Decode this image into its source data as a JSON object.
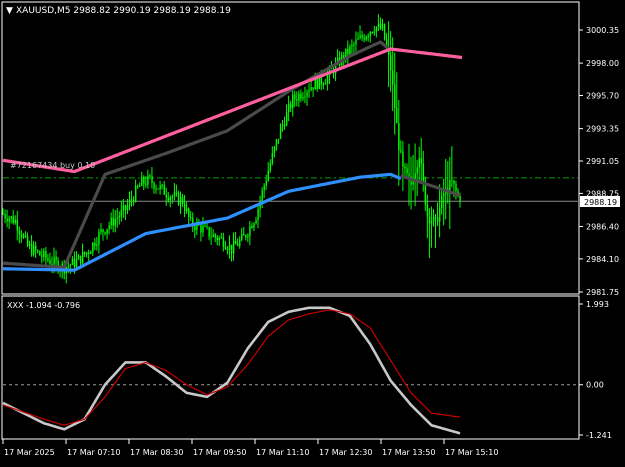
{
  "symbol_header": {
    "arrow": "▼",
    "text": "XAUUSD,M5  2988.82 2990.19 2988.19 2988.19"
  },
  "order_line_label": "#72167434 buy 0.10",
  "current_price_label": "2988.19",
  "price_axis": {
    "ticks": [
      "3000.35",
      "2998.00",
      "2995.70",
      "2993.35",
      "2991.05",
      "2988.75",
      "2986.40",
      "2984.10",
      "2981.75"
    ]
  },
  "indicator_header": "XXX -1.094 -0.796",
  "indicator_axis": {
    "ticks": [
      "1.993",
      "0.00",
      "-1.241"
    ]
  },
  "time_axis": {
    "labels": [
      "17 Mar 2025",
      "17 Mar 07:10",
      "17 Mar 08:30",
      "17 Mar 09:50",
      "17 Mar 11:10",
      "17 Mar 12:30",
      "17 Mar 13:50",
      "17 Mar 15:10"
    ]
  },
  "colors": {
    "background": "#000000",
    "candles": "#00ff00",
    "ma_dark": "#4a4a4a",
    "ma_blue": "#2f8fff",
    "ma_pink": "#ff5fa0",
    "order_line": "#00a000",
    "price_line": "#8c8c8c",
    "indicator_fast": "#c8c8c8",
    "indicator_slow": "#c80000",
    "axis": "#ffffff"
  },
  "chart_data": [
    {
      "type": "candlestick",
      "title": "XAUUSD,M5",
      "ohlc_last": {
        "open": 2988.82,
        "high": 2990.19,
        "low": 2988.19,
        "close": 2988.19
      },
      "approx_close_path": [
        [
          0,
          2987.3
        ],
        [
          6,
          2986.8
        ],
        [
          12,
          2985.0
        ],
        [
          18,
          2984.4
        ],
        [
          24,
          2983.9
        ],
        [
          30,
          2983.5
        ],
        [
          36,
          2983.9
        ],
        [
          42,
          2984.7
        ],
        [
          48,
          2986.0
        ],
        [
          54,
          2986.8
        ],
        [
          60,
          2987.6
        ],
        [
          64,
          2988.6
        ],
        [
          68,
          2989.5
        ],
        [
          72,
          2989.7
        ],
        [
          76,
          2989.2
        ],
        [
          82,
          2988.6
        ],
        [
          88,
          2988.2
        ],
        [
          92,
          2986.6
        ],
        [
          96,
          2986.4
        ],
        [
          102,
          2985.8
        ],
        [
          108,
          2985.4
        ],
        [
          112,
          2984.8
        ],
        [
          118,
          2985.6
        ],
        [
          124,
          2987.2
        ],
        [
          130,
          2990.4
        ],
        [
          136,
          2993.3
        ],
        [
          142,
          2995.4
        ],
        [
          150,
          2996.3
        ],
        [
          158,
          2996.9
        ],
        [
          166,
          2998.3
        ],
        [
          174,
          2999.6
        ],
        [
          182,
          3000.6
        ],
        [
          186,
          3000.4
        ],
        [
          190,
          2997.6
        ],
        [
          194,
          2992.2
        ],
        [
          196,
          2990.4
        ],
        [
          200,
          2989.4
        ],
        [
          204,
          2991.6
        ],
        [
          208,
          2987.2
        ],
        [
          212,
          2986.6
        ],
        [
          216,
          2988.7
        ],
        [
          220,
          2989.5
        ],
        [
          224,
          2988.19
        ]
      ],
      "moving_averages": [
        {
          "color": "#4a4a4a",
          "points": [
            [
              0,
              2983.8
            ],
            [
              30,
              2983.5
            ],
            [
              50,
              2990.1
            ],
            [
              80,
              2991.6
            ],
            [
              110,
              2993.2
            ],
            [
              140,
              2996.0
            ],
            [
              170,
              2998.5
            ],
            [
              185,
              2999.5
            ],
            [
              190,
              2998.9
            ]
          ]
        },
        {
          "color": "#ff5fa0",
          "points": [
            [
              0,
              2991.1
            ],
            [
              35,
              2990.3
            ],
            [
              190,
              2999.0
            ],
            [
              225,
              2998.4
            ]
          ]
        },
        {
          "color": "#2f8fff",
          "points": [
            [
              0,
              2983.4
            ],
            [
              35,
              2983.3
            ],
            [
              70,
              2985.9
            ],
            [
              110,
              2987.0
            ],
            [
              140,
              2988.9
            ],
            [
              175,
              2989.9
            ],
            [
              190,
              2990.1
            ],
            [
              195,
              2989.8
            ]
          ]
        },
        {
          "color": "#4a4a4a",
          "points": [
            [
              195,
              2990.0
            ],
            [
              212,
              2989.2
            ],
            [
              224,
              2988.6
            ]
          ]
        }
      ],
      "order_price": 2989.85,
      "current_price": 2988.19,
      "ylim": [
        2981.75,
        3000.35
      ]
    },
    {
      "type": "line",
      "title": "XXX",
      "values_current": [
        -1.094,
        -0.796
      ],
      "series": [
        {
          "values": [
            [
              0,
              -0.45
            ],
            [
              20,
              -0.95
            ],
            [
              30,
              -1.1
            ],
            [
              40,
              -0.85
            ],
            [
              50,
              0.0
            ],
            [
              60,
              0.55
            ],
            [
              70,
              0.55
            ],
            [
              80,
              0.2
            ],
            [
              90,
              -0.2
            ],
            [
              100,
              -0.3
            ],
            [
              110,
              0.05
            ],
            [
              120,
              0.9
            ],
            [
              130,
              1.55
            ],
            [
              140,
              1.8
            ],
            [
              150,
              1.9
            ],
            [
              160,
              1.9
            ],
            [
              170,
              1.7
            ],
            [
              180,
              1.0
            ],
            [
              190,
              0.1
            ],
            [
              200,
              -0.5
            ],
            [
              210,
              -1.0
            ],
            [
              224,
              -1.2
            ]
          ]
        },
        {
          "values": [
            [
              0,
              -0.5
            ],
            [
              20,
              -0.85
            ],
            [
              30,
              -1.0
            ],
            [
              40,
              -0.85
            ],
            [
              50,
              -0.3
            ],
            [
              60,
              0.4
            ],
            [
              70,
              0.55
            ],
            [
              80,
              0.35
            ],
            [
              90,
              0.0
            ],
            [
              100,
              -0.25
            ],
            [
              110,
              -0.05
            ],
            [
              120,
              0.5
            ],
            [
              130,
              1.2
            ],
            [
              140,
              1.6
            ],
            [
              150,
              1.75
            ],
            [
              160,
              1.85
            ],
            [
              170,
              1.75
            ],
            [
              180,
              1.4
            ],
            [
              190,
              0.6
            ],
            [
              200,
              -0.2
            ],
            [
              210,
              -0.7
            ],
            [
              224,
              -0.8
            ]
          ]
        }
      ],
      "ylim": [
        -1.241,
        1.993
      ]
    }
  ]
}
